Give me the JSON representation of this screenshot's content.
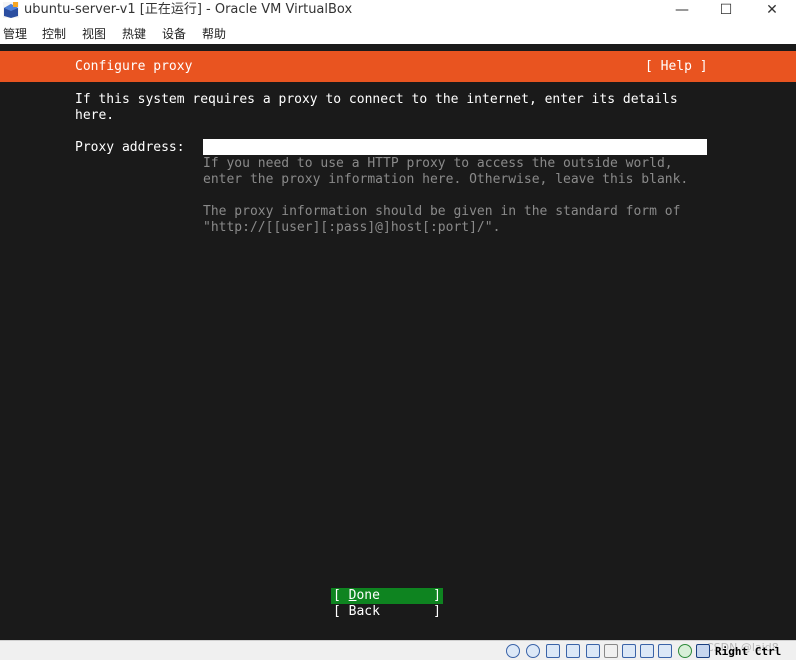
{
  "window": {
    "title": "ubuntu-server-v1 [正在运行] - Oracle VM VirtualBox",
    "minimize_glyph": "—",
    "maximize_glyph": "☐",
    "close_glyph": "✕",
    "icon": "virtualbox-icon"
  },
  "menu": {
    "items": [
      {
        "label": "管理"
      },
      {
        "label": "控制"
      },
      {
        "label": "视图"
      },
      {
        "label": "热键"
      },
      {
        "label": "设备"
      },
      {
        "label": "帮助"
      }
    ]
  },
  "installer": {
    "header_title": "Configure proxy",
    "help_label": "[ Help ]",
    "intro": "If this system requires a proxy to connect to the internet, enter its details\nhere.",
    "proxy_label": "Proxy address:",
    "proxy_value": "",
    "hint_1": "If you need to use a HTTP proxy to access the outside world,\nenter the proxy information here. Otherwise, leave this blank.",
    "hint_2": "The proxy information should be given in the standard form of\n\"http://[[user][:pass]@]host[:port]/\".",
    "done": {
      "open": "[ ",
      "hotkey": "D",
      "rest": "one",
      "close": "]"
    },
    "back": {
      "open": "[ ",
      "hotkey": "",
      "rest": "Back",
      "close": "]"
    },
    "colors": {
      "header": "#e95420",
      "done": "#0e8420",
      "background": "#1a1a1a"
    }
  },
  "statusbar": {
    "watermark": "CSDN @laid8",
    "host_key": "Right Ctrl",
    "icons": [
      "hard-disk-icon",
      "optical-drive-icon",
      "audio-icon",
      "network-icon",
      "usb-icon",
      "shared-folder-icon",
      "display-icon",
      "recording-icon",
      "cpu-icon",
      "mouse-integration-icon",
      "host-key-icon"
    ]
  }
}
